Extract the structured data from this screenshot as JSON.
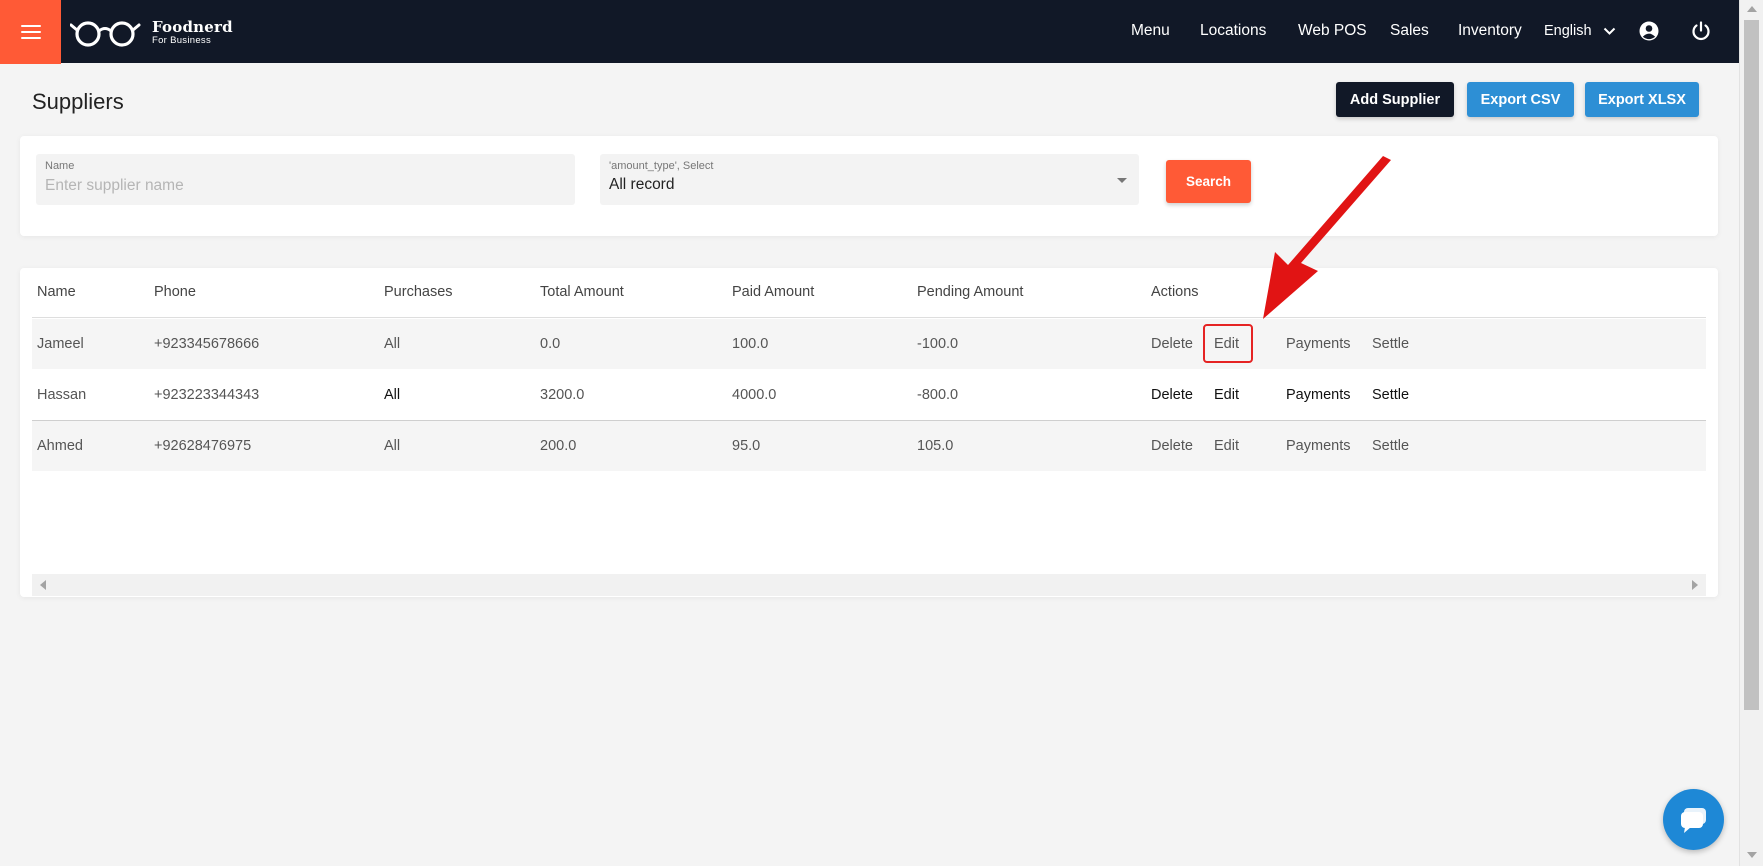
{
  "nav": {
    "brand_name": "Foodnerd",
    "brand_tagline": "For Business",
    "items": [
      "Menu",
      "Locations",
      "Web POS",
      "Sales",
      "Inventory"
    ],
    "language": "English"
  },
  "page": {
    "title": "Suppliers",
    "add_label": "Add Supplier",
    "export_csv_label": "Export CSV",
    "export_xlsx_label": "Export XLSX"
  },
  "filters": {
    "name_label": "Name",
    "name_placeholder": "Enter supplier name",
    "name_value": "",
    "type_label": "'amount_type', Select",
    "type_value": "All record",
    "search_label": "Search"
  },
  "table": {
    "columns": [
      "Name",
      "Phone",
      "Purchases",
      "Total Amount",
      "Paid Amount",
      "Pending Amount",
      "Actions"
    ],
    "action_labels": [
      "Delete",
      "Edit",
      "Payments",
      "Settle"
    ],
    "rows": [
      {
        "name": "Jameel",
        "phone": "+923345678666",
        "purchases": "All",
        "total": "0.0",
        "paid": "100.0",
        "pending": "-100.0"
      },
      {
        "name": "Hassan",
        "phone": "+923223344343",
        "purchases": "All",
        "total": "3200.0",
        "paid": "4000.0",
        "pending": "-800.0"
      },
      {
        "name": "Ahmed",
        "phone": "+92628476975",
        "purchases": "All",
        "total": "200.0",
        "paid": "95.0",
        "pending": "105.0"
      }
    ]
  },
  "colors": {
    "topbar": "#111827",
    "accent": "#ff5a36",
    "blue": "#2d8fd5",
    "annotation": "#e52323"
  },
  "icons": {
    "menu": "hamburger-icon",
    "logo": "glasses-icon",
    "language_dropdown": "chevron-down-icon",
    "account": "user-circle-icon",
    "logout": "power-icon",
    "chat": "chat-bubble-icon"
  }
}
